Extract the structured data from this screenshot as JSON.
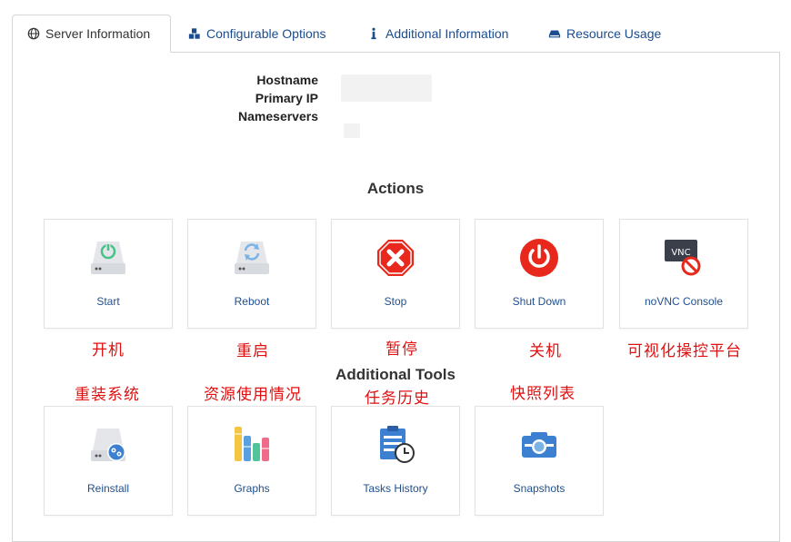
{
  "tabs": [
    {
      "label": "Server Information",
      "icon": "globe-icon",
      "active": true
    },
    {
      "label": "Configurable Options",
      "icon": "cubes-icon",
      "active": false
    },
    {
      "label": "Additional Information",
      "icon": "info-icon",
      "active": false
    },
    {
      "label": "Resource Usage",
      "icon": "hdd-icon",
      "active": false
    }
  ],
  "server_info": {
    "hostname_label": "Hostname",
    "primary_ip_label": "Primary IP",
    "nameservers_label": "Nameservers"
  },
  "actions": {
    "title": "Actions",
    "items": [
      {
        "label": "Start",
        "icon": "server-power-icon"
      },
      {
        "label": "Reboot",
        "icon": "server-reboot-icon"
      },
      {
        "label": "Stop",
        "icon": "stop-octagon-icon"
      },
      {
        "label": "Shut Down",
        "icon": "power-off-icon"
      },
      {
        "label": "noVNC Console",
        "icon": "vnc-console-icon"
      }
    ]
  },
  "tools": {
    "title": "Additional Tools",
    "items": [
      {
        "label": "Reinstall",
        "icon": "reinstall-icon"
      },
      {
        "label": "Graphs",
        "icon": "bar-graph-icon"
      },
      {
        "label": "Tasks History",
        "icon": "task-clock-icon"
      },
      {
        "label": "Snapshots",
        "icon": "camera-icon"
      }
    ]
  },
  "annotations": {
    "start": "开机",
    "reboot": "重启",
    "stop": "暂停",
    "shutdown": "关机",
    "vnc": "可视化操控平台",
    "reinstall": "重装系统",
    "graphs": "资源使用情况",
    "tasks": "任务历史",
    "snapshots": "快照列表"
  },
  "colors": {
    "link": "#1f4f8f",
    "annotation": "#e01010",
    "border": "#d6d6d6"
  }
}
